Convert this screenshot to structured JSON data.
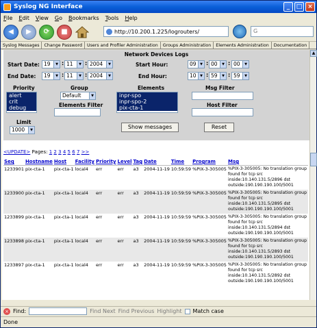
{
  "window": {
    "title": "Syslog NG Interface"
  },
  "menu": [
    "File",
    "Edit",
    "View",
    "Go",
    "Bookmarks",
    "Tools",
    "Help"
  ],
  "toolbar": {
    "url": "http://10.200.1.225/logrouters/",
    "search_value": "G"
  },
  "nav_tabs": [
    "Syslog Messages",
    "Change Password",
    "Users and Profiler Administration",
    "Groups Administration",
    "Elements Administration",
    "Documentation"
  ],
  "form": {
    "title": "Network Devices Logs",
    "start_date_label": "Start Date:",
    "end_date_label": "End Date:",
    "start_hour_label": "Start Hour:",
    "end_hour_label": "End Hour:",
    "start_date": {
      "day": "19",
      "month": "11",
      "year": "2004"
    },
    "end_date": {
      "day": "19",
      "month": "11",
      "year": "2004"
    },
    "start_hour": {
      "h": "09",
      "m": "00",
      "s": "00"
    },
    "end_hour": {
      "h": "10",
      "m": "59",
      "s": "59"
    },
    "priority_label": "Priority",
    "priority_items": [
      "alert",
      "crit",
      "debug"
    ],
    "group_label": "Group",
    "group_value": "Default",
    "elements_label": "Elements",
    "elements_items": [
      "inpr-spo",
      "inpr-spo-2",
      "pix-cta-1"
    ],
    "elements_filter_label": "Elements Filter",
    "msg_filter_label": "Msg Filter",
    "host_filter_label": "Host Filter",
    "limit_label": "Limit",
    "limit_value": "1000",
    "show_button": "Show messages",
    "reset_button": "Reset"
  },
  "pagination": {
    "update_link": "<UPDATE>",
    "pages_label": "Pages:",
    "pages": [
      "1",
      "2",
      "3",
      "4",
      "5",
      "6",
      "7"
    ],
    "next": ">>"
  },
  "table": {
    "headers": [
      "Seq",
      "Hostname",
      "Host",
      "Facility",
      "Priority",
      "Level",
      "Tag",
      "Date",
      "Time",
      "Program",
      "Msg"
    ],
    "rows": [
      [
        "1233901",
        "pix-cta-1",
        "pix-cta-1",
        "local4",
        "err",
        "err",
        "a3",
        "2004-11-19",
        "10:59:59",
        "%PIX-3-305005",
        "%PIX-3-305005: No translation group found for tcp src inside:10.140.131.5/2896 dst outside:190.190.190.100/5001"
      ],
      [
        "1233900",
        "pix-cta-1",
        "pix-cta-1",
        "local4",
        "err",
        "err",
        "a3",
        "2004-11-19",
        "10:59:59",
        "%PIX-3-305005",
        "%PIX-3-305005: No translation group found for tcp src inside:10.140.131.5/2895 dst outside:190.190.190.100/5001"
      ],
      [
        "1233899",
        "pix-cta-1",
        "pix-cta-1",
        "local4",
        "err",
        "err",
        "a3",
        "2004-11-19",
        "10:59:59",
        "%PIX-3-305005",
        "%PIX-3-305005: No translation group found for tcp src inside:10.140.131.5/2894 dst outside:190.190.190.100/5001"
      ],
      [
        "1233898",
        "pix-cta-1",
        "pix-cta-1",
        "local4",
        "err",
        "err",
        "a3",
        "2004-11-19",
        "10:59:59",
        "%PIX-3-305005",
        "%PIX-3-305005: No translation group found for tcp src inside:10.140.131.5/2893 dst outside:190.190.190.100/5001"
      ],
      [
        "1233897",
        "pix-cta-1",
        "pix-cta-1",
        "local4",
        "err",
        "err",
        "a3",
        "2004-11-19",
        "10:59:59",
        "%PIX-3-305005",
        "%PIX-3-305005: No translation group found for tcp src inside:10.140.131.5/2892 dst outside:190.190.190.100/5001"
      ]
    ]
  },
  "findbar": {
    "label": "Find:",
    "find_next": "Find Next",
    "find_previous": "Find Previous",
    "highlight": "Highlight",
    "match_case": "Match case"
  },
  "status": {
    "text": "Done"
  }
}
